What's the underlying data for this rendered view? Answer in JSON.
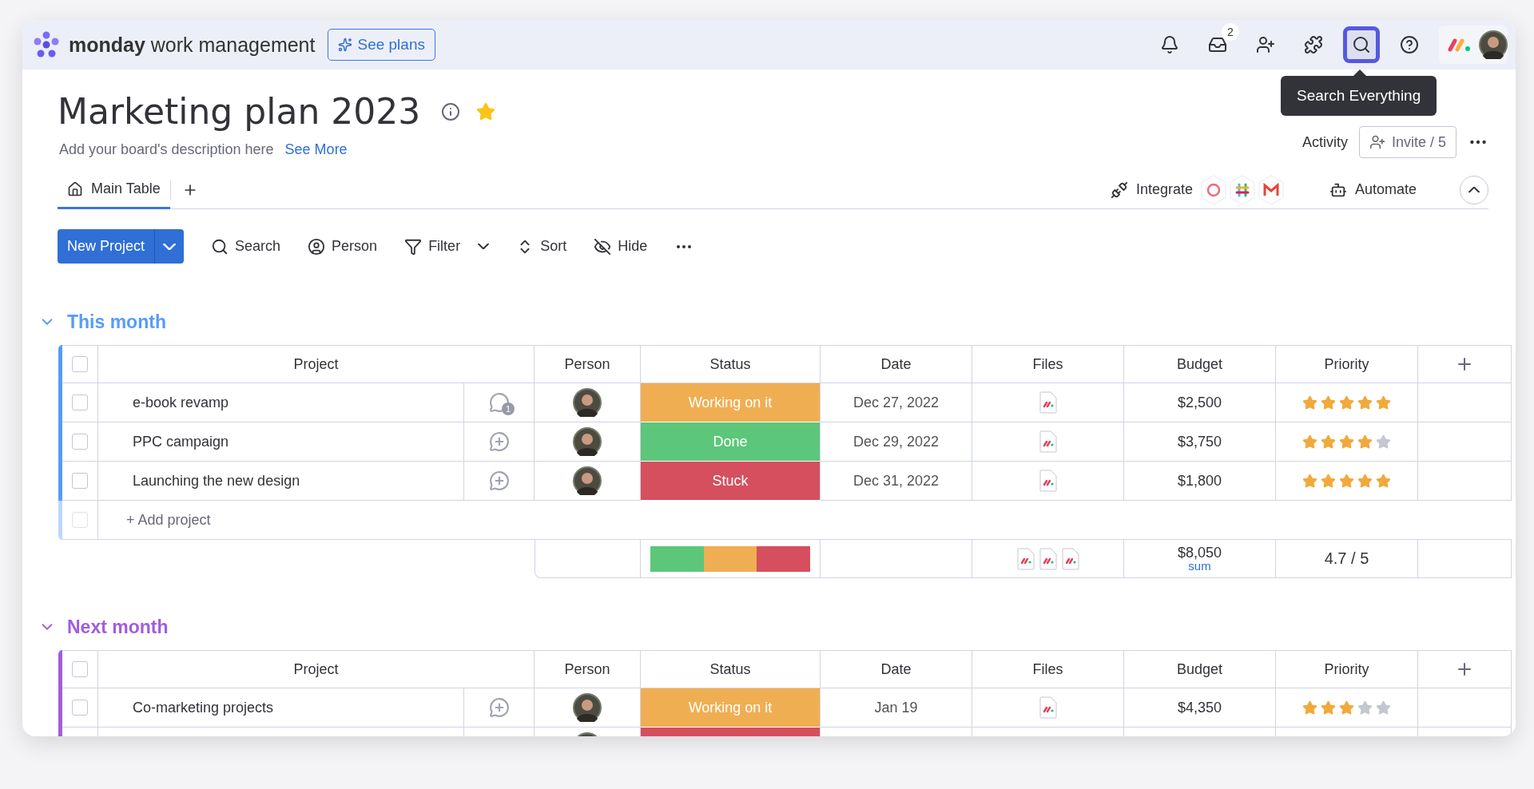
{
  "topbar": {
    "brand_bold": "monday",
    "brand_rest": "work management",
    "plans_button": "See plans",
    "inbox_badge": "2",
    "search_selected": true,
    "tooltip": "Search Everything"
  },
  "board": {
    "title": "Marketing plan 2023",
    "starred": true,
    "description": "Add your board's description here",
    "see_more": "See More",
    "activity": "Activity",
    "invite": "Invite / 5"
  },
  "views": {
    "tabs": [
      {
        "label": "Main Table",
        "selected": true
      }
    ],
    "integrate": "Integrate",
    "automate": "Automate"
  },
  "toolbar": {
    "new_button": "New Project",
    "items": [
      {
        "kind": "search",
        "label": "Search"
      },
      {
        "kind": "person",
        "label": "Person"
      },
      {
        "kind": "filter",
        "label": "Filter"
      },
      {
        "kind": "sort",
        "label": "Sort"
      },
      {
        "kind": "hide",
        "label": "Hide"
      }
    ]
  },
  "groups": [
    {
      "title": "This month",
      "color": "#579bfc",
      "all_checked": false,
      "columns": [
        "Project",
        "Person",
        "Status",
        "Date",
        "Files",
        "Budget",
        "Priority"
      ],
      "rows": [
        {
          "checked": false,
          "name": "e-book revamp",
          "comment": {
            "kind": "count",
            "count": "1"
          },
          "status": {
            "label": "Working on it",
            "color": "#f0ae52"
          },
          "date": "Dec 27, 2022",
          "files": [
            {
              "kind": "doc"
            }
          ],
          "budget": "$2,500",
          "stars": 5
        },
        {
          "checked": false,
          "name": "PPC campaign",
          "comment": {
            "kind": "add"
          },
          "status": {
            "label": "Done",
            "color": "#5cc67a"
          },
          "date": "Dec 29, 2022",
          "files": [
            {
              "kind": "doc"
            }
          ],
          "budget": "$3,750",
          "stars": 4
        },
        {
          "checked": false,
          "name": "Launching the new design",
          "comment": {
            "kind": "add"
          },
          "status": {
            "label": "Stuck",
            "color": "#d54f5e"
          },
          "date": "Dec 31, 2022",
          "files": [
            {
              "kind": "doc"
            }
          ],
          "budget": "$1,800",
          "stars": 5
        }
      ],
      "add_row": {
        "label": "+ Add project",
        "checked": false
      },
      "summary": {
        "status_segments": [
          {
            "color": "#5cc67a"
          },
          {
            "color": "#f0ae52"
          },
          {
            "color": "#d54f5e"
          }
        ],
        "files": [
          {
            "kind": "doc"
          },
          {
            "kind": "doc"
          },
          {
            "kind": "doc"
          }
        ],
        "budget": "$8,050",
        "budget_caption": "sum",
        "priority": "4.7 / 5"
      }
    },
    {
      "title": "Next month",
      "color": "#a25ddc",
      "all_checked": false,
      "columns": [
        "Project",
        "Person",
        "Status",
        "Date",
        "Files",
        "Budget",
        "Priority"
      ],
      "rows": [
        {
          "checked": false,
          "name": "Co-marketing projects",
          "comment": {
            "kind": "add"
          },
          "status": {
            "label": "Working on it",
            "color": "#f0ae52"
          },
          "date": "Jan 19",
          "files": [
            {
              "kind": "doc"
            }
          ],
          "budget": "$4,350",
          "stars": 3
        },
        {
          "status": {
            "color": "#d54f5e"
          }
        }
      ]
    }
  ]
}
